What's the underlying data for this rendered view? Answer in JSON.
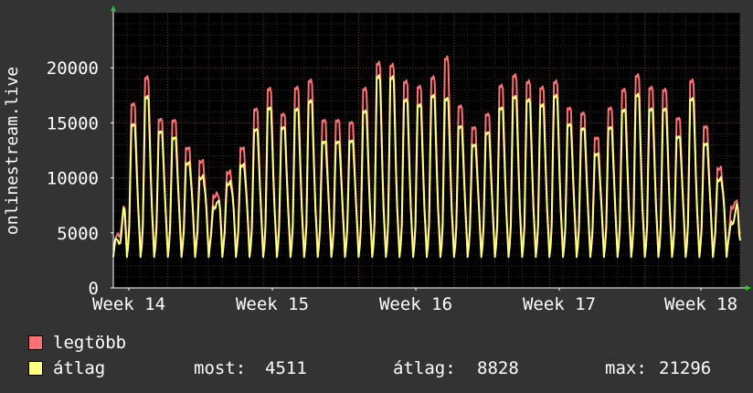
{
  "chart_data": {
    "type": "area",
    "ylabel": "onlinestream.live",
    "ylim": [
      0,
      25000
    ],
    "yticks": [
      0,
      5000,
      10000,
      15000,
      20000
    ],
    "xticks": [
      "Week 14",
      "Week 15",
      "Week 16",
      "Week 17",
      "Week 18"
    ],
    "grid": true,
    "series": [
      {
        "name": "legtöbb",
        "color": "#ff7070",
        "daily_peaks": [
          5000,
          17800,
          20400,
          16300,
          16200,
          13500,
          12200,
          8800,
          11100,
          13500,
          17300,
          19300,
          16800,
          19400,
          20100,
          16200,
          16200,
          16000,
          19300,
          21800,
          21600,
          20000,
          19500,
          20400,
          22300,
          17600,
          15500,
          16800,
          19600,
          20600,
          20000,
          19400,
          20000,
          17400,
          16900,
          14500,
          17400,
          19200,
          20600,
          19400,
          19200,
          16400,
          20100,
          15600,
          11500,
          7700
        ]
      },
      {
        "name": "átlag",
        "color": "#ffff80",
        "daily_peaks": [
          4300,
          15800,
          18500,
          15100,
          14500,
          12000,
          10600,
          7700,
          10000,
          11800,
          15300,
          17400,
          15500,
          17300,
          18100,
          14100,
          14100,
          14200,
          17100,
          20500,
          20400,
          18200,
          17700,
          18600,
          18300,
          15600,
          13800,
          15000,
          17400,
          18500,
          18200,
          17700,
          18600,
          15800,
          15400,
          12900,
          15500,
          17200,
          18700,
          17300,
          17300,
          14600,
          18300,
          13900,
          10400,
          6200
        ]
      }
    ],
    "stats": {
      "most_label": "most:",
      "most": "4511",
      "atlag_label": "átlag:",
      "atlag": "8828",
      "max_label": "max:",
      "max": "21296"
    }
  },
  "colors": {
    "background": "#333333",
    "plot_bg": "#000000",
    "grid": "#5a3a3a",
    "axis": "#ffffff",
    "arrow": "#22cc22"
  }
}
